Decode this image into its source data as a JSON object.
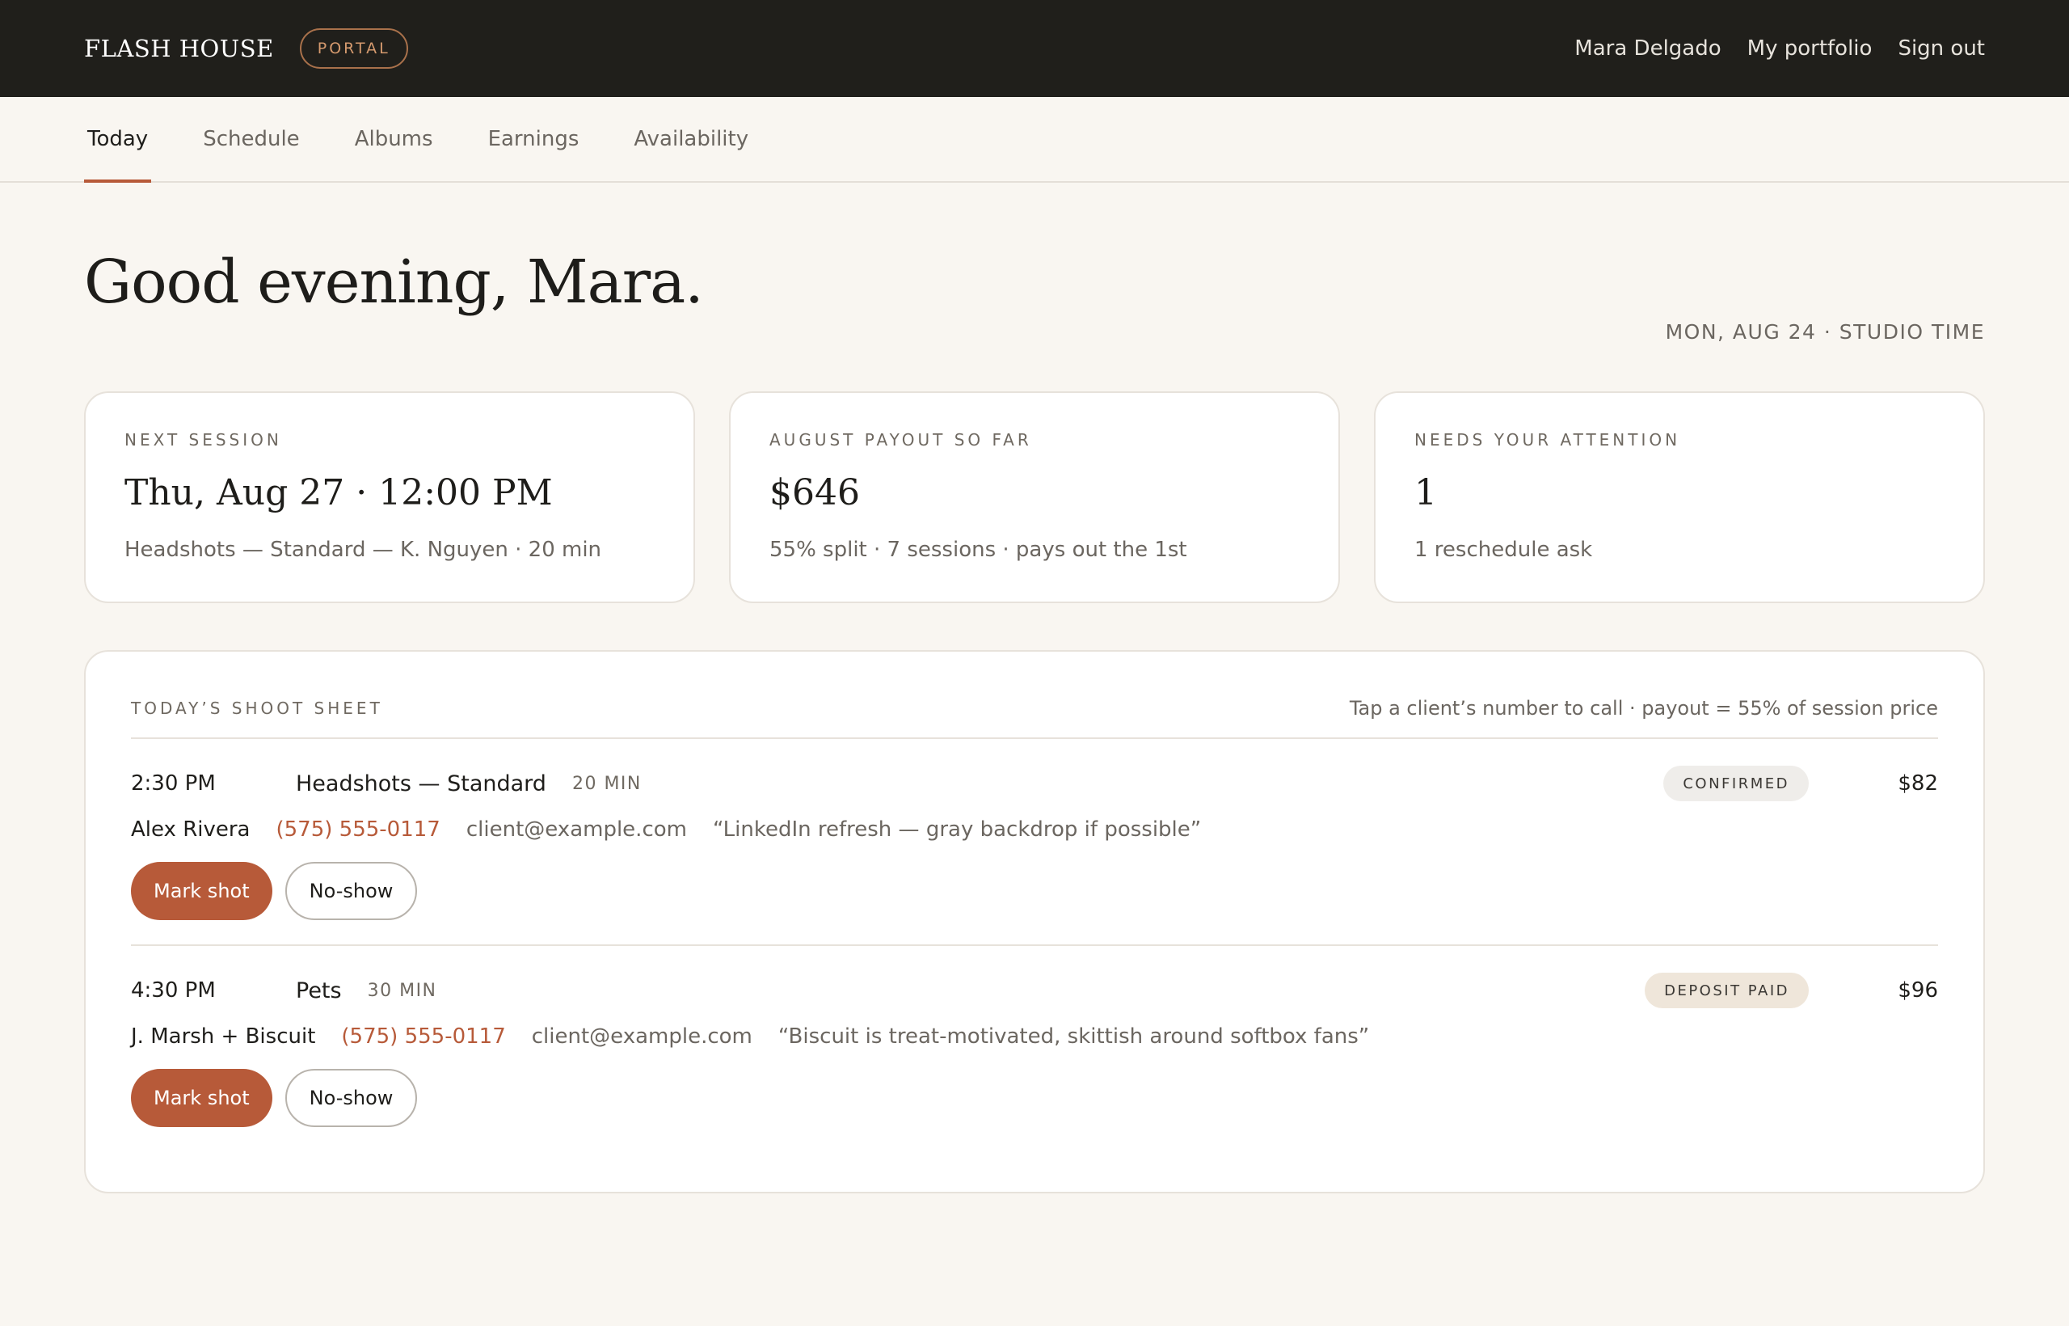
{
  "header": {
    "brand": "FLASH HOUSE",
    "badge": "PORTAL",
    "user_name": "Mara Delgado",
    "portfolio_link": "My portfolio",
    "signout_link": "Sign out"
  },
  "tabs": [
    {
      "label": "Today",
      "active": true
    },
    {
      "label": "Schedule",
      "active": false
    },
    {
      "label": "Albums",
      "active": false
    },
    {
      "label": "Earnings",
      "active": false
    },
    {
      "label": "Availability",
      "active": false
    }
  ],
  "greeting": "Good evening, Mara.",
  "date_line": "MON, AUG 24 · STUDIO TIME",
  "cards": [
    {
      "label": "NEXT SESSION",
      "value": "Thu, Aug 27 · 12:00 PM",
      "sub": "Headshots — Standard — K. Nguyen · 20 min"
    },
    {
      "label": "AUGUST PAYOUT SO FAR",
      "value": "$646",
      "sub": "55% split · 7 sessions · pays out the 1st"
    },
    {
      "label": "NEEDS YOUR ATTENTION",
      "value": "1",
      "sub": "1 reschedule ask"
    }
  ],
  "sheet": {
    "title": "TODAY’S SHOOT SHEET",
    "note": "Tap a client’s number to call · payout = 55% of session price",
    "shoots": [
      {
        "time": "2:30 PM",
        "type": "Headshots — Standard",
        "duration": "20 MIN",
        "status": "CONFIRMED",
        "price": "$82",
        "client": "Alex Rivera",
        "phone": "(575) 555-0117",
        "email": "client@example.com",
        "note": "“LinkedIn refresh — gray backdrop if possible”",
        "primary_action": "Mark shot",
        "secondary_action": "No-show"
      },
      {
        "time": "4:30 PM",
        "type": "Pets",
        "duration": "30 MIN",
        "status": "DEPOSIT PAID",
        "price": "$96",
        "client": "J. Marsh + Biscuit",
        "phone": "(575) 555-0117",
        "email": "client@example.com",
        "note": "“Biscuit is treat-motivated, skittish around softbox fans”",
        "primary_action": "Mark shot",
        "secondary_action": "No-show"
      }
    ]
  },
  "colors": {
    "topbar": "#201f1b",
    "accent": "#b75a39",
    "background": "#f9f6f1"
  }
}
